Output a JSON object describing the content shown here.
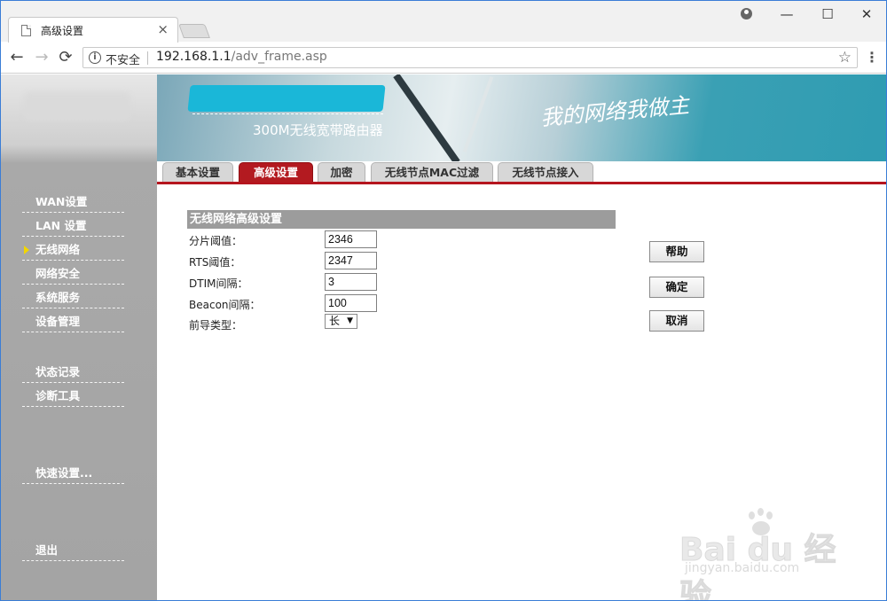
{
  "browser": {
    "tab_title": "高级设置",
    "tab_close": "×",
    "window_controls": {
      "minimize": "—",
      "maximize": "☐",
      "close": "✕"
    },
    "nav": {
      "back": "←",
      "forward": "→",
      "reload": "⟳"
    },
    "security_label": "不安全",
    "info_icon": "i",
    "url_host": "192.168.1.1",
    "url_path": "/adv_frame.asp",
    "star": "☆",
    "menu": "⋮"
  },
  "banner": {
    "product": "300M无线宽带路由器",
    "slogan": "我的网络我做主"
  },
  "sidebar": {
    "items": [
      {
        "label": "WAN设置"
      },
      {
        "label": "LAN 设置"
      },
      {
        "label": "无线网络",
        "active": true
      },
      {
        "label": "网络安全"
      },
      {
        "label": "系统服务"
      },
      {
        "label": "设备管理"
      },
      {
        "label": "状态记录"
      },
      {
        "label": "诊断工具"
      },
      {
        "label": "快速设置..."
      },
      {
        "label": "退出"
      }
    ]
  },
  "tabs": [
    {
      "label": "基本设置"
    },
    {
      "label": "高级设置",
      "active": true
    },
    {
      "label": "加密"
    },
    {
      "label": "无线节点MAC过滤"
    },
    {
      "label": "无线节点接入"
    }
  ],
  "form": {
    "title": "无线网络高级设置",
    "fields": [
      {
        "label": "分片阈值：",
        "value": "2346"
      },
      {
        "label": "RTS阈值：",
        "value": "2347"
      },
      {
        "label": "DTIM间隔：",
        "value": "3"
      },
      {
        "label": "Beacon间隔：",
        "value": "100"
      }
    ],
    "preamble_label": "前导类型：",
    "preamble_value": "长",
    "preamble_arrow": "▼"
  },
  "buttons": {
    "help": "帮助",
    "ok": "确定",
    "cancel": "取消"
  },
  "watermark": {
    "brand": "Bai du 经验",
    "site": "jingyan.baidu.com"
  },
  "colors": {
    "accent_red": "#b31a20",
    "sidebar_gray": "#a4a4a4",
    "section_gray": "#9c9c9c"
  }
}
